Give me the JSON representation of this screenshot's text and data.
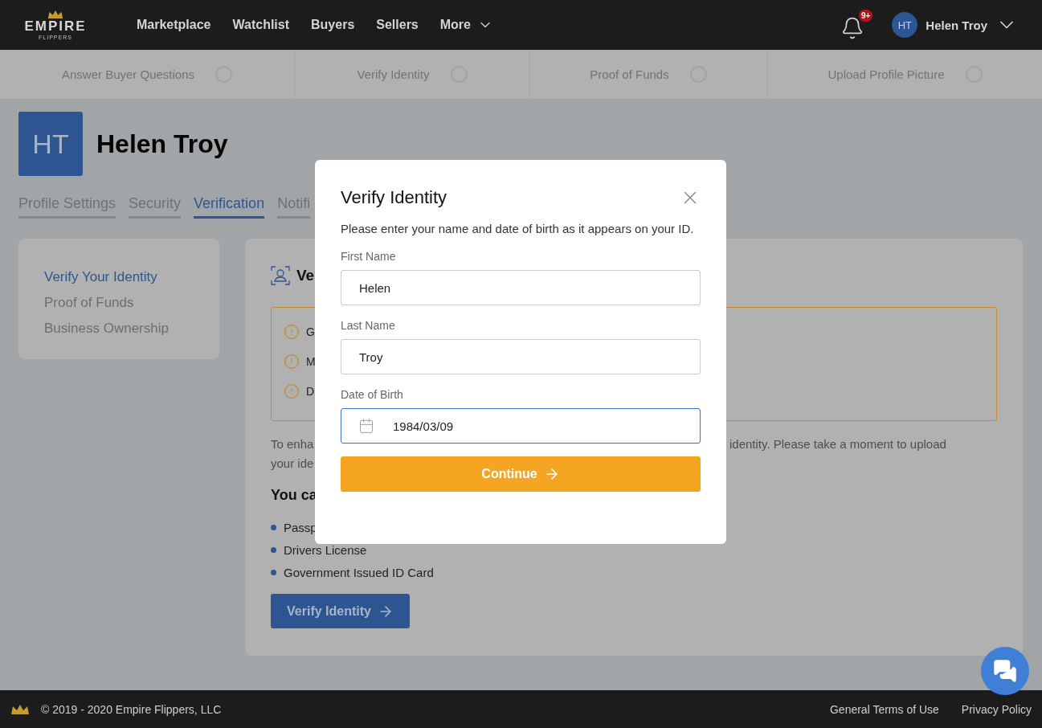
{
  "header": {
    "logo": {
      "name": "EMPIRE",
      "tagline": "FLIPPERS"
    },
    "nav": [
      {
        "label": "Marketplace",
        "dropdown": false
      },
      {
        "label": "Watchlist",
        "dropdown": false
      },
      {
        "label": "Buyers",
        "dropdown": false
      },
      {
        "label": "Sellers",
        "dropdown": false
      },
      {
        "label": "More",
        "dropdown": true
      }
    ],
    "notifications": {
      "badge": "9+"
    },
    "user": {
      "initials": "HT",
      "name": "Helen Troy"
    }
  },
  "steps": [
    {
      "label": "Answer Buyer Questions",
      "done": false
    },
    {
      "label": "Verify Identity",
      "done": false
    },
    {
      "label": "Proof of Funds",
      "done": false
    },
    {
      "label": "Upload Profile Picture",
      "done": false
    }
  ],
  "profile": {
    "initials": "HT",
    "name": "Helen Troy"
  },
  "tabs": [
    {
      "label": "Profile Settings",
      "selected": false
    },
    {
      "label": "Security",
      "selected": false
    },
    {
      "label": "Verification",
      "selected": true
    },
    {
      "label": "Notifi",
      "selected": false
    }
  ],
  "sidebar": {
    "items": [
      {
        "label": "Verify Your Identity",
        "selected": true
      },
      {
        "label": "Proof of Funds",
        "selected": false
      },
      {
        "label": "Business Ownership",
        "selected": false
      }
    ]
  },
  "content": {
    "title": "Ve",
    "alerts": [
      "G",
      "M",
      "D"
    ],
    "intro": [
      {
        "left": "To enha",
        "right": "identity. Please take a moment to upload"
      },
      {
        "left": "your ide"
      }
    ],
    "subtitle": "You ca",
    "documents": [
      "Passp",
      "Drivers License",
      "Government Issued ID Card"
    ],
    "button": "Verify Identity"
  },
  "modal": {
    "title": "Verify Identity",
    "description": "Please enter your name and date of birth as it appears on your ID.",
    "fields": [
      {
        "label": "First Name",
        "value": "Helen",
        "kind": "text",
        "focused": false
      },
      {
        "label": "Last Name",
        "value": "Troy",
        "kind": "text",
        "focused": false
      },
      {
        "label": "Date of Birth",
        "value": "1984/03/09",
        "kind": "date",
        "focused": true
      }
    ],
    "button": "Continue"
  },
  "footer": {
    "copyright": "© 2019 - 2020 Empire Flippers, LLC",
    "links": [
      "General Terms of Use",
      "Privacy Policy"
    ]
  }
}
